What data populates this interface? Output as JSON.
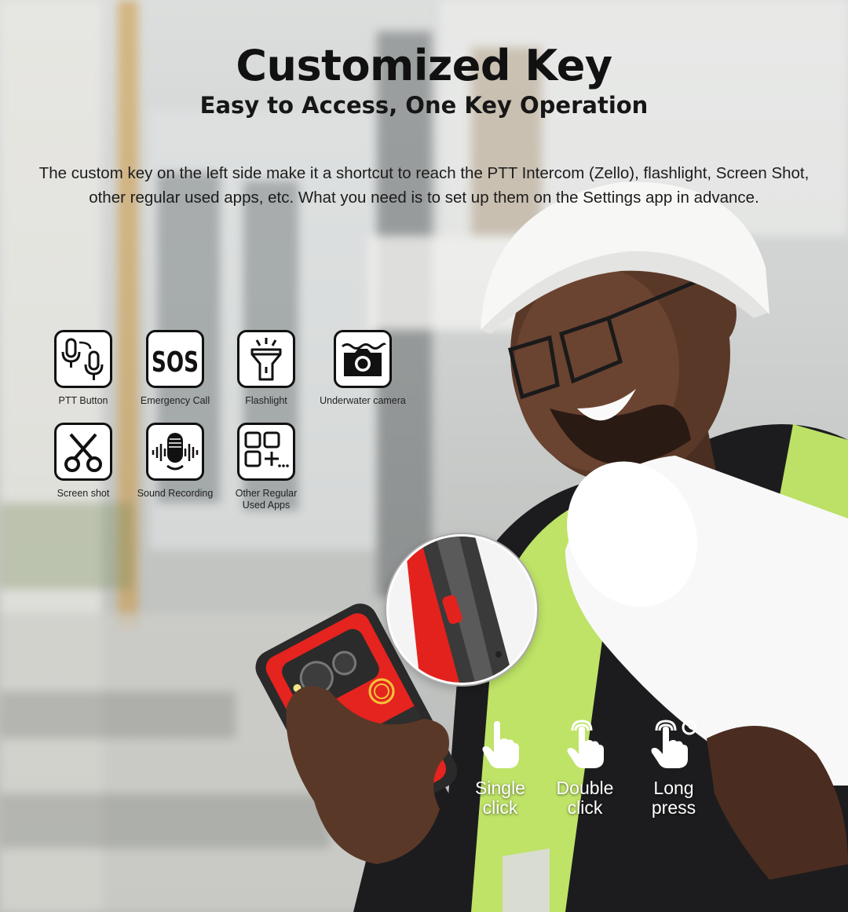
{
  "header": {
    "title": "Customized Key",
    "subtitle": "Easy to Access, One Key Operation"
  },
  "description": {
    "line1": "The custom key on the left side make it a shortcut to reach the PTT Intercom (Zello), flashlight, Screen Shot,",
    "line2": "other regular used apps, etc. What you need is to set  up them on the Settings app in advance."
  },
  "features": [
    {
      "label": "PTT Button",
      "icon": "ptt-icon"
    },
    {
      "label": "Emergency Call",
      "icon": "sos-icon"
    },
    {
      "label": "Flashlight",
      "icon": "flashlight-icon"
    },
    {
      "label": "Underwater camera",
      "icon": "underwater-camera-icon"
    },
    {
      "label": "Screen shot",
      "icon": "scissors-icon"
    },
    {
      "label": "Sound Recording",
      "icon": "microphone-icon"
    },
    {
      "label": "Other Regular Used Apps",
      "label_line1": "Other Regular",
      "label_line2": "Used Apps",
      "icon": "apps-grid-icon"
    }
  ],
  "gestures": [
    {
      "line1": "Single",
      "line2": "click",
      "icon": "single-tap-icon"
    },
    {
      "line1": "Double",
      "line2": "click",
      "icon": "double-tap-icon"
    },
    {
      "line1": "Long",
      "line2": "press",
      "icon": "long-press-icon"
    }
  ],
  "colors": {
    "phone_red": "#e5231f",
    "vest": "#c8f06a",
    "text": "#111111"
  }
}
